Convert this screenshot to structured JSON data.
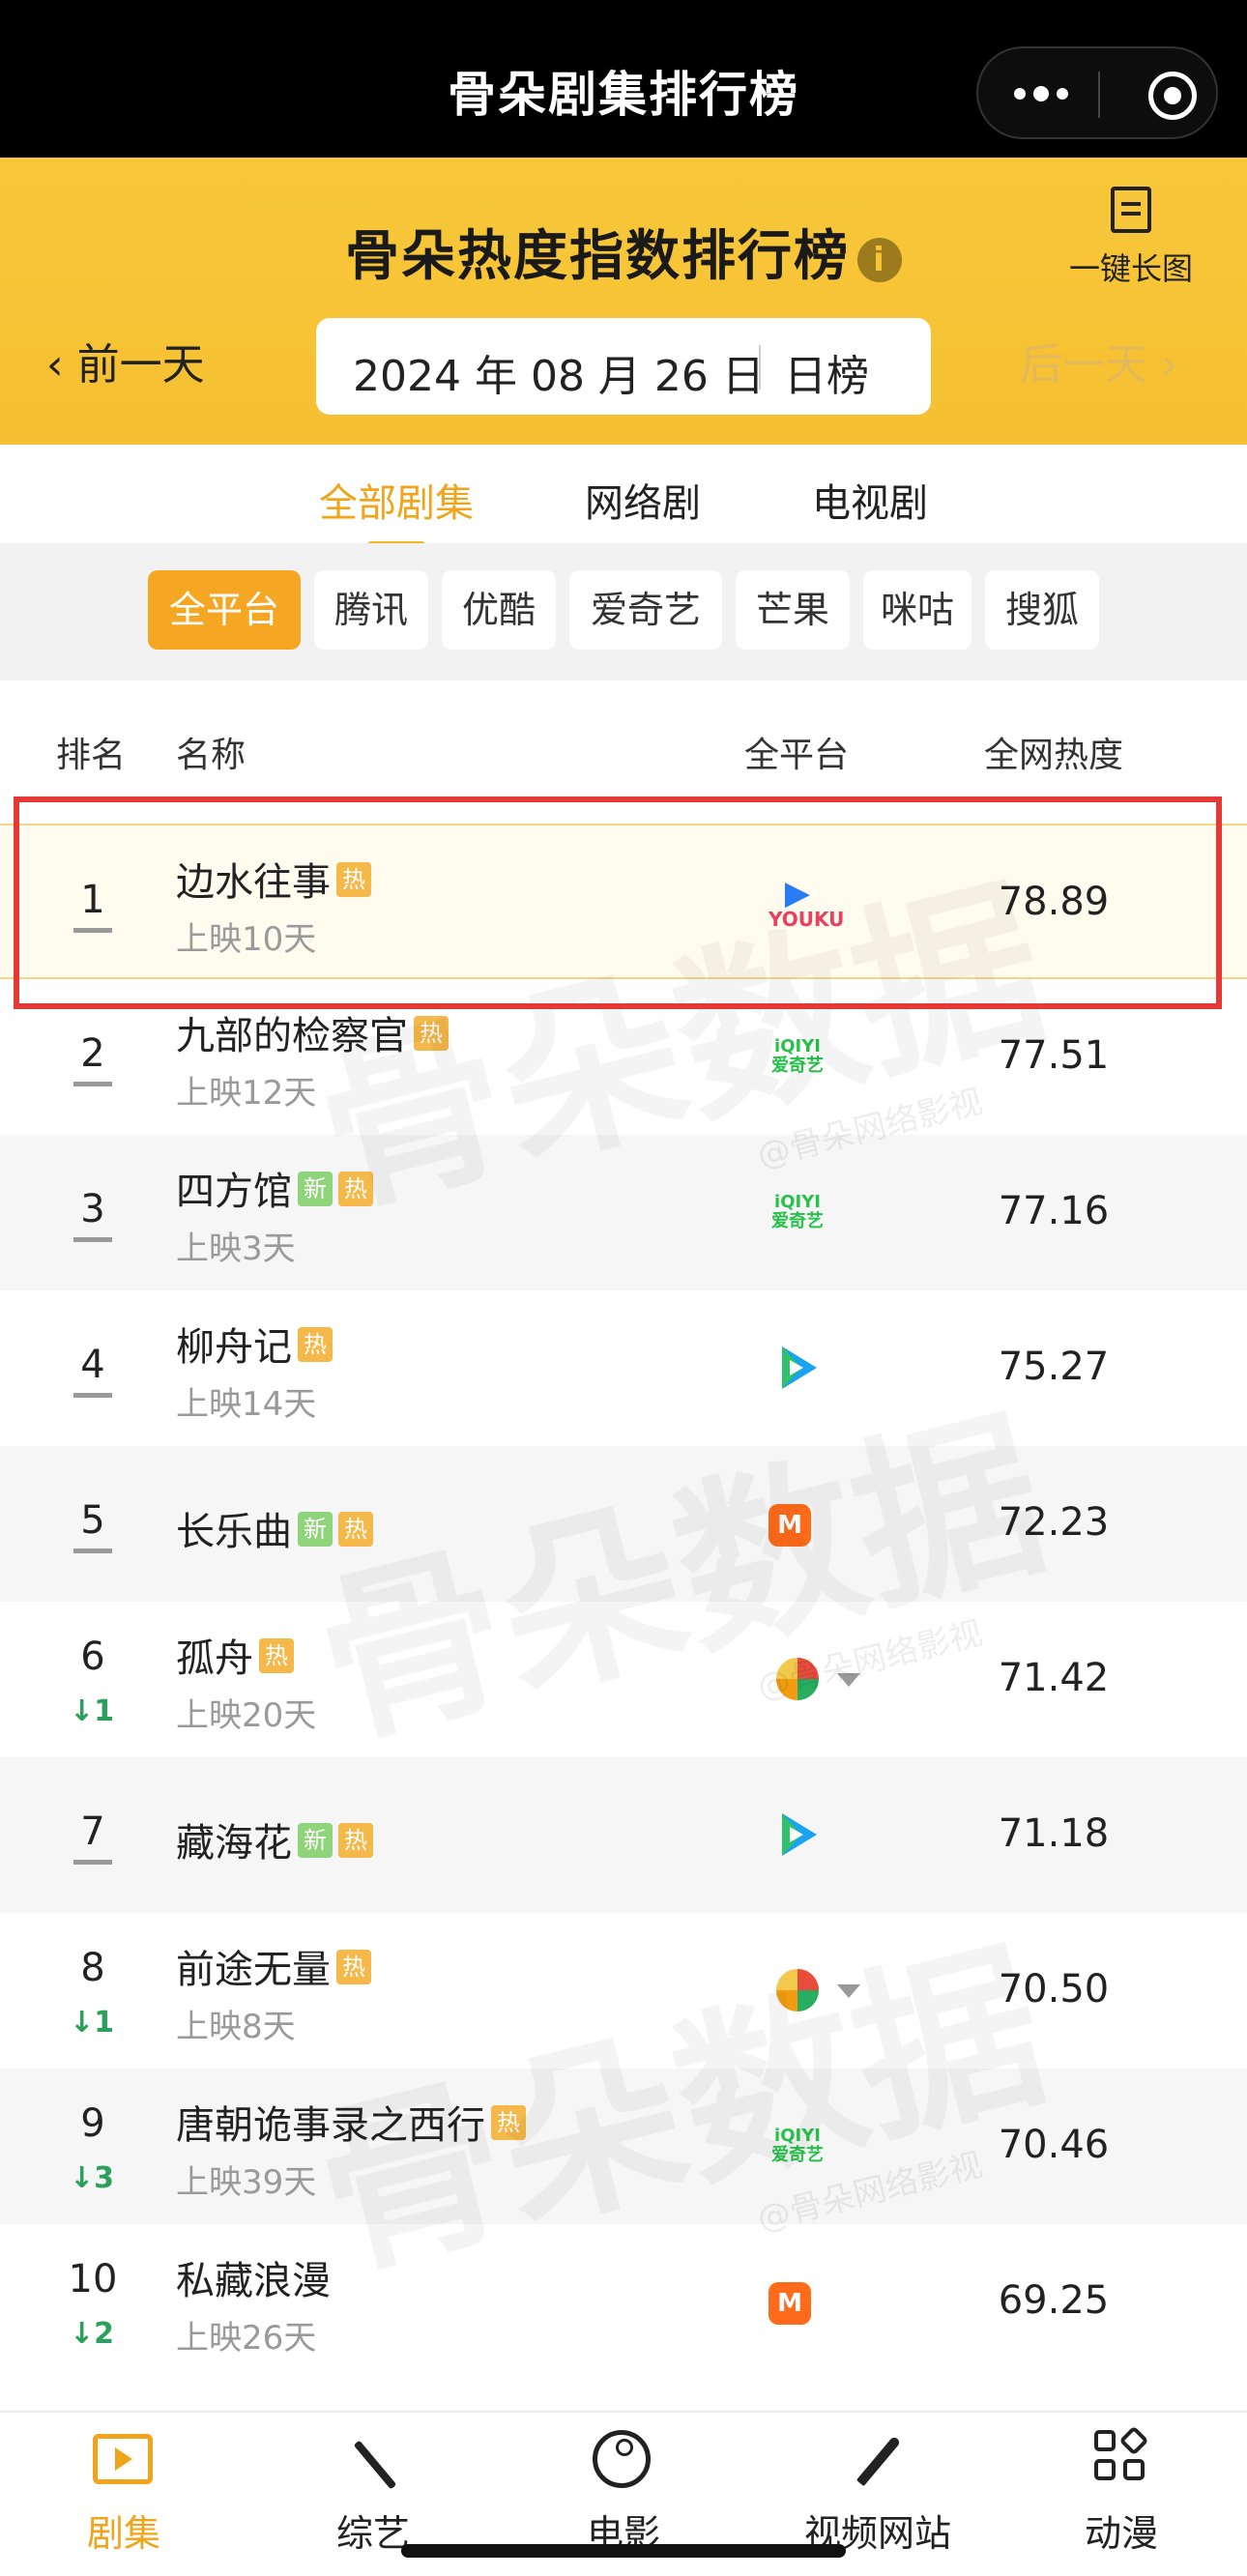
{
  "topbar": {
    "title": "骨朵剧集排行榜"
  },
  "header": {
    "title": "骨朵热度指数排行榜",
    "info_icon": "i",
    "long_image_label": "一键长图",
    "prev_day": "‹ 前一天",
    "next_day": "后一天 ›",
    "date": "2024 年 08 月 26 日",
    "mode": "日榜"
  },
  "category_tabs": [
    {
      "label": "全部剧集",
      "active": true
    },
    {
      "label": "网络剧",
      "active": false
    },
    {
      "label": "电视剧",
      "active": false
    }
  ],
  "platform_chips": [
    {
      "label": "全平台",
      "active": true
    },
    {
      "label": "腾讯",
      "active": false
    },
    {
      "label": "优酷",
      "active": false
    },
    {
      "label": "爱奇艺",
      "active": false
    },
    {
      "label": "芒果",
      "active": false
    },
    {
      "label": "咪咕",
      "active": false
    },
    {
      "label": "搜狐",
      "active": false
    }
  ],
  "table_header": {
    "rank": "排名",
    "name": "名称",
    "platform": "全平台",
    "heat": "全网热度"
  },
  "rows": [
    {
      "rank": "1",
      "name": "边水往事",
      "badges": [
        "热"
      ],
      "days": "上映10天",
      "platform": "youku",
      "heat": "78.89",
      "change": ""
    },
    {
      "rank": "2",
      "name": "九部的检察官",
      "badges": [
        "热"
      ],
      "days": "上映12天",
      "platform": "iqiyi",
      "heat": "77.51",
      "change": ""
    },
    {
      "rank": "3",
      "name": "四方馆",
      "badges": [
        "新",
        "热"
      ],
      "days": "上映3天",
      "platform": "iqiyi",
      "heat": "77.16",
      "change": ""
    },
    {
      "rank": "4",
      "name": "柳舟记",
      "badges": [
        "热"
      ],
      "days": "上映14天",
      "platform": "tencent",
      "heat": "75.27",
      "change": ""
    },
    {
      "rank": "5",
      "name": "长乐曲",
      "badges": [
        "新",
        "热"
      ],
      "days": "",
      "platform": "mgtv",
      "heat": "72.23",
      "change": ""
    },
    {
      "rank": "6",
      "name": "孤舟",
      "badges": [
        "热"
      ],
      "days": "上映20天",
      "platform": "multi",
      "heat": "71.42",
      "change": "↓1"
    },
    {
      "rank": "7",
      "name": "藏海花",
      "badges": [
        "新",
        "热"
      ],
      "days": "",
      "platform": "tencent",
      "heat": "71.18",
      "change": ""
    },
    {
      "rank": "8",
      "name": "前途无量",
      "badges": [
        "热"
      ],
      "days": "上映8天",
      "platform": "multi",
      "heat": "70.50",
      "change": "↓1"
    },
    {
      "rank": "9",
      "name": "唐朝诡事录之西行",
      "badges": [
        "热"
      ],
      "days": "上映39天",
      "platform": "iqiyi",
      "heat": "70.46",
      "change": "↓3"
    },
    {
      "rank": "10",
      "name": "私藏浪漫",
      "badges": [],
      "days": "上映26天",
      "platform": "mgtv",
      "heat": "69.25",
      "change": "↓2"
    }
  ],
  "platform_logos": {
    "youku": "YOUKU",
    "iqiyi_top": "iQIYI",
    "iqiyi_bottom": "爱奇艺",
    "mgtv": "M"
  },
  "watermark": {
    "big": "骨朵数据",
    "small": "@骨朵网络影视"
  },
  "bottom_nav": [
    {
      "label": "剧集",
      "icon": "tv-play-icon",
      "active": true
    },
    {
      "label": "综艺",
      "icon": "magic-wand-icon",
      "active": false
    },
    {
      "label": "电影",
      "icon": "film-reel-icon",
      "active": false
    },
    {
      "label": "视频网站",
      "icon": "brush-icon",
      "active": false
    },
    {
      "label": "动漫",
      "icon": "grid-icon",
      "active": false
    }
  ],
  "colors": {
    "accent": "#f5a623",
    "header_yellow": "#f7c435",
    "highlight_red": "#e53935",
    "down_green": "#2aa05a"
  }
}
